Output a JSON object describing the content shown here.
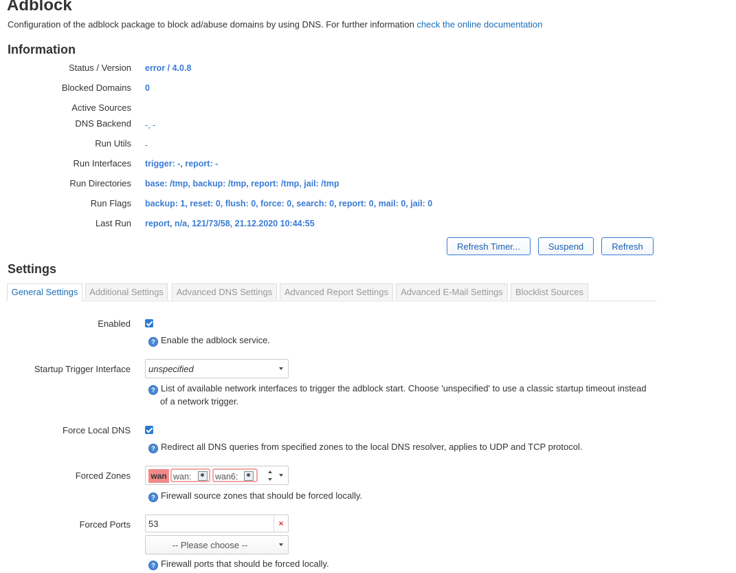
{
  "page": {
    "title": "Adblock",
    "description": "Configuration of the adblock package to block ad/abuse domains by using DNS. For further information ",
    "doc_link": "check the online documentation"
  },
  "information": {
    "title": "Information",
    "rows": [
      {
        "label": "Status / Version",
        "value": "error / 4.0.8"
      },
      {
        "label": "Blocked Domains",
        "value": "0"
      },
      {
        "label": "Active Sources",
        "value": ""
      },
      {
        "label": "DNS Backend",
        "value": "-, -"
      },
      {
        "label": "Run Utils",
        "value": "-"
      },
      {
        "label": "Run Interfaces",
        "value": "trigger: -, report: -"
      },
      {
        "label": "Run Directories",
        "value": "base: /tmp, backup: /tmp, report: /tmp, jail: /tmp"
      },
      {
        "label": "Run Flags",
        "value": "backup: 1, reset: 0, flush: 0, force: 0, search: 0, report: 0, mail: 0, jail: 0"
      },
      {
        "label": "Last Run",
        "value": "report, n/a, 121/73/58, 21.12.2020 10:44:55"
      }
    ],
    "buttons": {
      "refresh_timer": "Refresh Timer...",
      "suspend": "Suspend",
      "refresh": "Refresh"
    }
  },
  "settings": {
    "title": "Settings",
    "tabs": [
      {
        "label": "General Settings",
        "active": true
      },
      {
        "label": "Additional Settings",
        "active": false
      },
      {
        "label": "Advanced DNS Settings",
        "active": false
      },
      {
        "label": "Advanced Report Settings",
        "active": false
      },
      {
        "label": "Advanced E-Mail Settings",
        "active": false
      },
      {
        "label": "Blocklist Sources",
        "active": false
      }
    ],
    "enabled": {
      "label": "Enabled",
      "checked": true,
      "help": "Enable the adblock service."
    },
    "startup_trigger": {
      "label": "Startup Trigger Interface",
      "value": "unspecified",
      "help": "List of available network interfaces to trigger the adblock start. Choose 'unspecified' to use a classic startup timeout instead of a network trigger."
    },
    "force_local_dns": {
      "label": "Force Local DNS",
      "checked": true,
      "help": "Redirect all DNS queries from specified zones to the local DNS resolver, applies to UDP and TCP protocol."
    },
    "forced_zones": {
      "label": "Forced Zones",
      "active_zone": "wan",
      "chips": [
        "wan:",
        "wan6:"
      ],
      "help": "Firewall source zones that should be forced locally."
    },
    "forced_ports": {
      "label": "Forced Ports",
      "value": "53",
      "remove_symbol": "×",
      "choose_placeholder": "-- Please choose --",
      "help": "Firewall ports that should be forced locally."
    }
  },
  "colors": {
    "link": "#1a6fb8",
    "value": "#3a7bd5",
    "zone_active": "#f08a8a"
  }
}
